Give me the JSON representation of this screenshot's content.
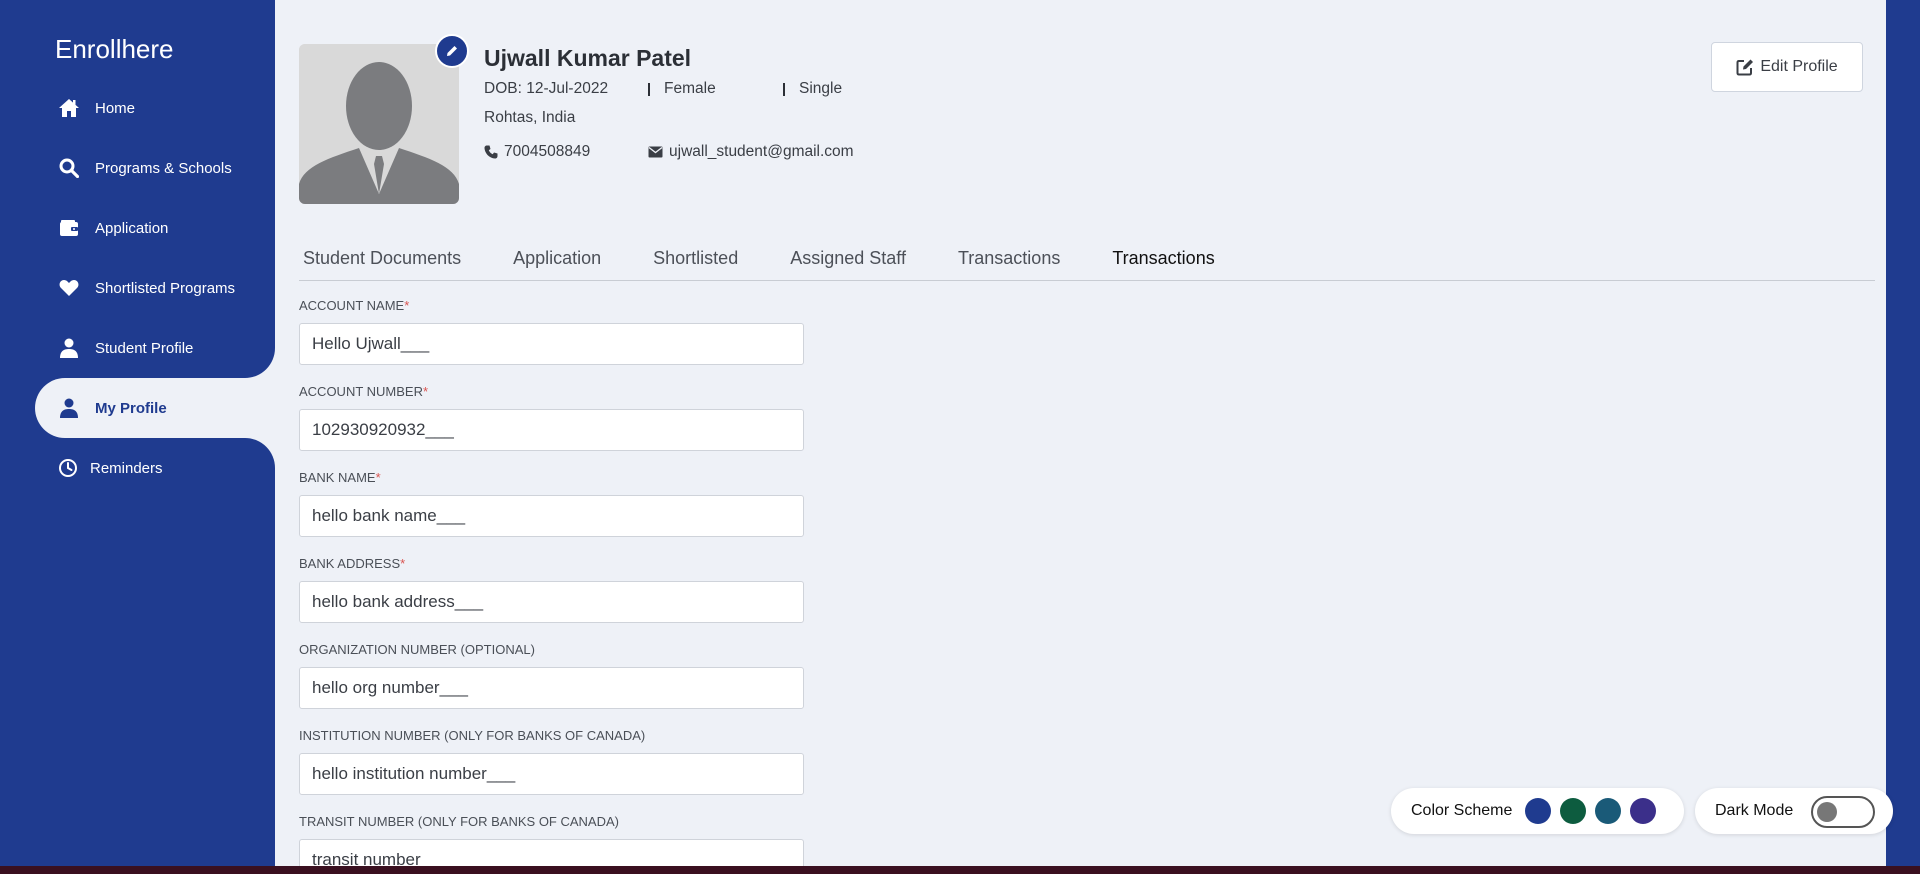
{
  "app": {
    "brand": "Enrollhere"
  },
  "sidebar": {
    "items": [
      {
        "label": "Home",
        "icon": "home-icon"
      },
      {
        "label": "Programs & Schools",
        "icon": "search-icon"
      },
      {
        "label": "Application",
        "icon": "wallet-icon"
      },
      {
        "label": "Shortlisted Programs",
        "icon": "heart-icon"
      },
      {
        "label": "Student Profile",
        "icon": "user-icon"
      },
      {
        "label": "My Profile",
        "icon": "user-icon",
        "active": true
      },
      {
        "label": "Reminders",
        "icon": "clock-icon"
      }
    ]
  },
  "profile": {
    "name": "Ujwall Kumar Patel",
    "dob": "DOB: 12-Jul-2022",
    "gender": "Female",
    "marital": "Single",
    "location": "Rohtas, India",
    "phone": "7004508849",
    "email": "ujwall_student@gmail.com",
    "edit_label": "Edit Profile"
  },
  "tabs": [
    {
      "label": "Student Documents"
    },
    {
      "label": "Application"
    },
    {
      "label": "Shortlisted"
    },
    {
      "label": "Assigned Staff"
    },
    {
      "label": "Transactions"
    },
    {
      "label": "Transactions",
      "active": true
    }
  ],
  "form": {
    "account_name": {
      "label": "ACCOUNT NAME",
      "required": "*",
      "value": "Hello Ujwall___"
    },
    "account_number": {
      "label": "ACCOUNT NUMBER",
      "required": "*",
      "value": "102930920932___"
    },
    "bank_name": {
      "label": "BANK NAME",
      "required": "*",
      "value": "hello bank name___"
    },
    "bank_address": {
      "label": "BANK ADDRESS",
      "required": "*",
      "value": "hello bank address___"
    },
    "org_number": {
      "label": "ORGANIZATION NUMBER (OPTIONAL)",
      "value": "hello org number___"
    },
    "institution_number": {
      "label": "INSTITUTION NUMBER (ONLY FOR BANKS OF CANADA)",
      "value": "hello institution number___"
    },
    "transit_number": {
      "label": "TRANSIT NUMBER (ONLY FOR BANKS OF CANADA)",
      "value": "transit number"
    }
  },
  "footer": {
    "color_scheme_label": "Color Scheme",
    "dark_mode_label": "Dark Mode",
    "dark_mode_on": false,
    "scheme_colors": [
      "#1f3b8f",
      "#0d5c3f",
      "#1a5a78",
      "#3b2f8a"
    ]
  }
}
